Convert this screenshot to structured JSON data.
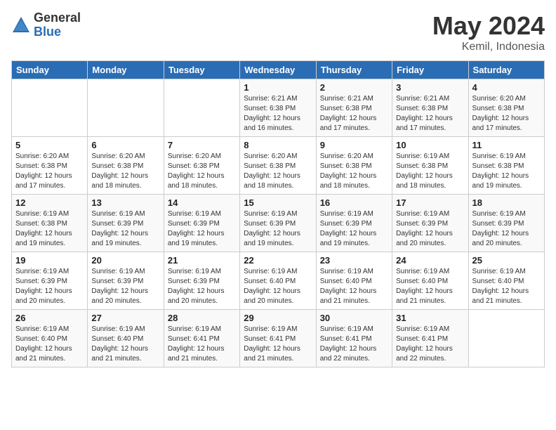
{
  "logo": {
    "general": "General",
    "blue": "Blue"
  },
  "title": "May 2024",
  "location": "Kemil, Indonesia",
  "days_of_week": [
    "Sunday",
    "Monday",
    "Tuesday",
    "Wednesday",
    "Thursday",
    "Friday",
    "Saturday"
  ],
  "weeks": [
    [
      {
        "day": "",
        "info": ""
      },
      {
        "day": "",
        "info": ""
      },
      {
        "day": "",
        "info": ""
      },
      {
        "day": "1",
        "info": "Sunrise: 6:21 AM\nSunset: 6:38 PM\nDaylight: 12 hours\nand 16 minutes."
      },
      {
        "day": "2",
        "info": "Sunrise: 6:21 AM\nSunset: 6:38 PM\nDaylight: 12 hours\nand 17 minutes."
      },
      {
        "day": "3",
        "info": "Sunrise: 6:21 AM\nSunset: 6:38 PM\nDaylight: 12 hours\nand 17 minutes."
      },
      {
        "day": "4",
        "info": "Sunrise: 6:20 AM\nSunset: 6:38 PM\nDaylight: 12 hours\nand 17 minutes."
      }
    ],
    [
      {
        "day": "5",
        "info": "Sunrise: 6:20 AM\nSunset: 6:38 PM\nDaylight: 12 hours\nand 17 minutes."
      },
      {
        "day": "6",
        "info": "Sunrise: 6:20 AM\nSunset: 6:38 PM\nDaylight: 12 hours\nand 18 minutes."
      },
      {
        "day": "7",
        "info": "Sunrise: 6:20 AM\nSunset: 6:38 PM\nDaylight: 12 hours\nand 18 minutes."
      },
      {
        "day": "8",
        "info": "Sunrise: 6:20 AM\nSunset: 6:38 PM\nDaylight: 12 hours\nand 18 minutes."
      },
      {
        "day": "9",
        "info": "Sunrise: 6:20 AM\nSunset: 6:38 PM\nDaylight: 12 hours\nand 18 minutes."
      },
      {
        "day": "10",
        "info": "Sunrise: 6:19 AM\nSunset: 6:38 PM\nDaylight: 12 hours\nand 18 minutes."
      },
      {
        "day": "11",
        "info": "Sunrise: 6:19 AM\nSunset: 6:38 PM\nDaylight: 12 hours\nand 19 minutes."
      }
    ],
    [
      {
        "day": "12",
        "info": "Sunrise: 6:19 AM\nSunset: 6:38 PM\nDaylight: 12 hours\nand 19 minutes."
      },
      {
        "day": "13",
        "info": "Sunrise: 6:19 AM\nSunset: 6:39 PM\nDaylight: 12 hours\nand 19 minutes."
      },
      {
        "day": "14",
        "info": "Sunrise: 6:19 AM\nSunset: 6:39 PM\nDaylight: 12 hours\nand 19 minutes."
      },
      {
        "day": "15",
        "info": "Sunrise: 6:19 AM\nSunset: 6:39 PM\nDaylight: 12 hours\nand 19 minutes."
      },
      {
        "day": "16",
        "info": "Sunrise: 6:19 AM\nSunset: 6:39 PM\nDaylight: 12 hours\nand 19 minutes."
      },
      {
        "day": "17",
        "info": "Sunrise: 6:19 AM\nSunset: 6:39 PM\nDaylight: 12 hours\nand 20 minutes."
      },
      {
        "day": "18",
        "info": "Sunrise: 6:19 AM\nSunset: 6:39 PM\nDaylight: 12 hours\nand 20 minutes."
      }
    ],
    [
      {
        "day": "19",
        "info": "Sunrise: 6:19 AM\nSunset: 6:39 PM\nDaylight: 12 hours\nand 20 minutes."
      },
      {
        "day": "20",
        "info": "Sunrise: 6:19 AM\nSunset: 6:39 PM\nDaylight: 12 hours\nand 20 minutes."
      },
      {
        "day": "21",
        "info": "Sunrise: 6:19 AM\nSunset: 6:39 PM\nDaylight: 12 hours\nand 20 minutes."
      },
      {
        "day": "22",
        "info": "Sunrise: 6:19 AM\nSunset: 6:40 PM\nDaylight: 12 hours\nand 20 minutes."
      },
      {
        "day": "23",
        "info": "Sunrise: 6:19 AM\nSunset: 6:40 PM\nDaylight: 12 hours\nand 21 minutes."
      },
      {
        "day": "24",
        "info": "Sunrise: 6:19 AM\nSunset: 6:40 PM\nDaylight: 12 hours\nand 21 minutes."
      },
      {
        "day": "25",
        "info": "Sunrise: 6:19 AM\nSunset: 6:40 PM\nDaylight: 12 hours\nand 21 minutes."
      }
    ],
    [
      {
        "day": "26",
        "info": "Sunrise: 6:19 AM\nSunset: 6:40 PM\nDaylight: 12 hours\nand 21 minutes."
      },
      {
        "day": "27",
        "info": "Sunrise: 6:19 AM\nSunset: 6:40 PM\nDaylight: 12 hours\nand 21 minutes."
      },
      {
        "day": "28",
        "info": "Sunrise: 6:19 AM\nSunset: 6:41 PM\nDaylight: 12 hours\nand 21 minutes."
      },
      {
        "day": "29",
        "info": "Sunrise: 6:19 AM\nSunset: 6:41 PM\nDaylight: 12 hours\nand 21 minutes."
      },
      {
        "day": "30",
        "info": "Sunrise: 6:19 AM\nSunset: 6:41 PM\nDaylight: 12 hours\nand 22 minutes."
      },
      {
        "day": "31",
        "info": "Sunrise: 6:19 AM\nSunset: 6:41 PM\nDaylight: 12 hours\nand 22 minutes."
      },
      {
        "day": "",
        "info": ""
      }
    ]
  ]
}
